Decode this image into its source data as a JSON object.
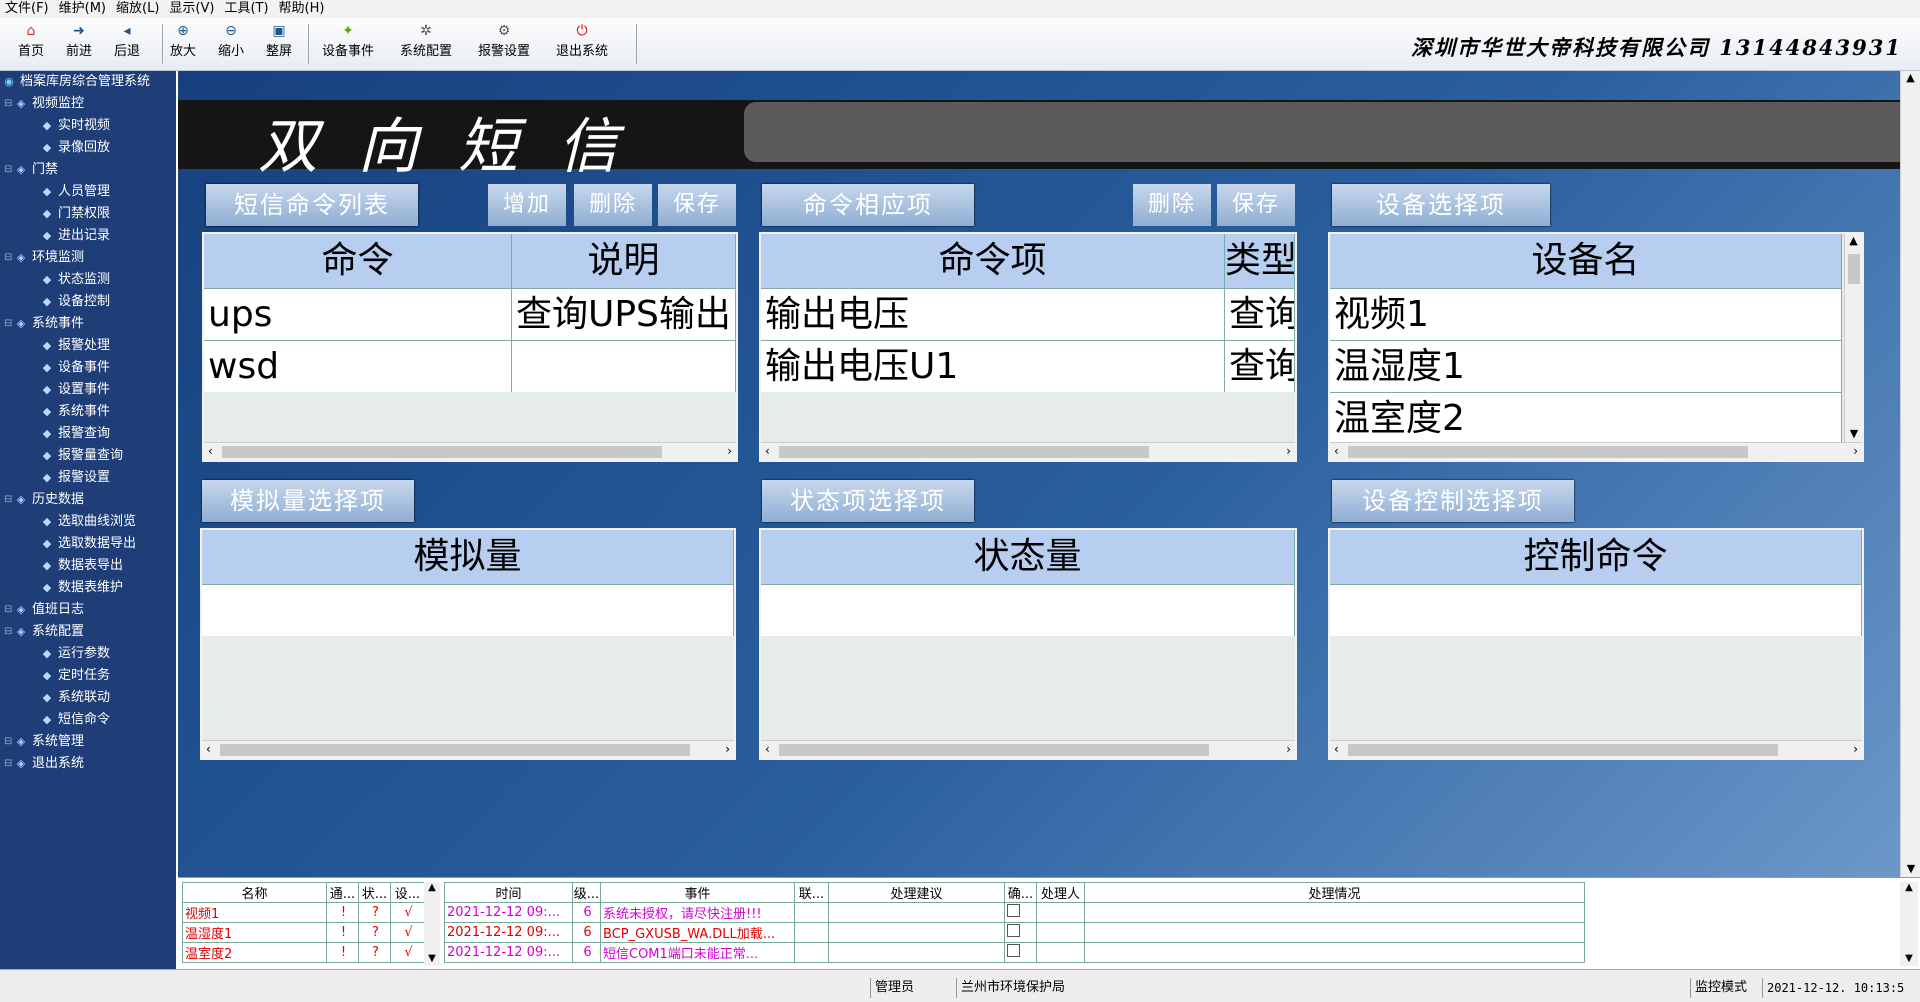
{
  "menu": [
    "文件(F)",
    "维护(M)",
    "缩放(L)",
    "显示(V)",
    "工具(T)",
    "帮助(H)"
  ],
  "toolbar": {
    "buttons": [
      {
        "label": "首页",
        "icon": "home-icon"
      },
      {
        "label": "前进",
        "icon": "forward-icon"
      },
      {
        "label": "后退",
        "icon": "back-icon"
      },
      {
        "label": "放大",
        "icon": "zoom-in-icon"
      },
      {
        "label": "缩小",
        "icon": "zoom-out-icon"
      },
      {
        "label": "整屏",
        "icon": "fullscreen-icon"
      },
      {
        "label": "设备事件",
        "icon": "device-event-icon"
      },
      {
        "label": "系统配置",
        "icon": "config-icon"
      },
      {
        "label": "报警设置",
        "icon": "alarm-settings-icon"
      },
      {
        "label": "退出系统",
        "icon": "exit-icon"
      }
    ],
    "company": "深圳市华世大帝科技有限公司   13144843931"
  },
  "sidebar": {
    "root": "档案库房综合管理系统",
    "items": [
      {
        "label": "视频监控",
        "level": 1
      },
      {
        "label": "实时视频",
        "level": 2
      },
      {
        "label": "录像回放",
        "level": 2
      },
      {
        "label": "门禁",
        "level": 1
      },
      {
        "label": "人员管理",
        "level": 2
      },
      {
        "label": "门禁权限",
        "level": 2
      },
      {
        "label": "进出记录",
        "level": 2
      },
      {
        "label": "环境监测",
        "level": 1
      },
      {
        "label": "状态监测",
        "level": 2
      },
      {
        "label": "设备控制",
        "level": 2
      },
      {
        "label": "系统事件",
        "level": 1
      },
      {
        "label": "报警处理",
        "level": 2
      },
      {
        "label": "设备事件",
        "level": 2
      },
      {
        "label": "设置事件",
        "level": 2
      },
      {
        "label": "系统事件",
        "level": 2
      },
      {
        "label": "报警查询",
        "level": 2
      },
      {
        "label": "报警量查询",
        "level": 2
      },
      {
        "label": "报警设置",
        "level": 2
      },
      {
        "label": "历史数据",
        "level": 1
      },
      {
        "label": "选取曲线浏览",
        "level": 2
      },
      {
        "label": "选取数据导出",
        "level": 2
      },
      {
        "label": "数据表导出",
        "level": 2
      },
      {
        "label": "数据表维护",
        "level": 2
      },
      {
        "label": "值班日志",
        "level": 1
      },
      {
        "label": "系统配置",
        "level": 1
      },
      {
        "label": "运行参数",
        "level": 2
      },
      {
        "label": "定时任务",
        "level": 2
      },
      {
        "label": "系统联动",
        "level": 2
      },
      {
        "label": "短信命令",
        "level": 2
      },
      {
        "label": "系统管理",
        "level": 1
      },
      {
        "label": "退出系统",
        "level": 1
      }
    ]
  },
  "main": {
    "title": "双向短信",
    "cmd_list": {
      "label": "短信命令列表",
      "add": "增加",
      "delete": "删除",
      "save": "保存",
      "headers": [
        "命令",
        "说明"
      ],
      "rows": [
        [
          "ups",
          "查询UPS输出电"
        ],
        [
          "wsd",
          ""
        ]
      ]
    },
    "cmd_items": {
      "label": "命令相应项",
      "delete": "删除",
      "save": "保存",
      "headers": [
        "命令项",
        "类型"
      ],
      "rows": [
        [
          "输出电压",
          "查询"
        ],
        [
          "输出电压U1",
          "查询"
        ]
      ]
    },
    "device_select": {
      "label": "设备选择项",
      "headers": [
        "设备名"
      ],
      "rows": [
        [
          "视频1"
        ],
        [
          "温湿度1"
        ],
        [
          "温室度2"
        ]
      ]
    },
    "analog": {
      "label": "模拟量选择项",
      "header": "模拟量"
    },
    "status": {
      "label": "状态项选择项",
      "header": "状态量"
    },
    "control": {
      "label": "设备控制选择项",
      "header": "控制命令"
    }
  },
  "device_table": {
    "headers": [
      "名称",
      "通...",
      "状...",
      "设..."
    ],
    "rows": [
      [
        "视频1",
        "!",
        "?",
        "√"
      ],
      [
        "温湿度1",
        "!",
        "?",
        "√"
      ],
      [
        "温室度2",
        "!",
        "?",
        "√"
      ]
    ]
  },
  "event_table": {
    "headers": [
      "时间",
      "级...",
      "事件",
      "联...",
      "处理建议",
      "确...",
      "处理人",
      "处理情况"
    ],
    "rows": [
      {
        "time": "2021-12-12 09:...",
        "level": "6",
        "event": "系统未授权，请尽快注册!!!",
        "color": "#d400d4"
      },
      {
        "time": "2021-12-12 09:...",
        "level": "6",
        "event": "BCP_GXUSB_WA.DLL加载...",
        "color": "#e00000"
      },
      {
        "time": "2021-12-12 09:...",
        "level": "6",
        "event": "短信COM1端口未能正常...",
        "color": "#d400d4"
      }
    ]
  },
  "statusbar": {
    "user": "管理员",
    "org": "兰州市环境保护局",
    "mode": "监控模式",
    "datetime": "2021-12-12.  10:13:5"
  }
}
